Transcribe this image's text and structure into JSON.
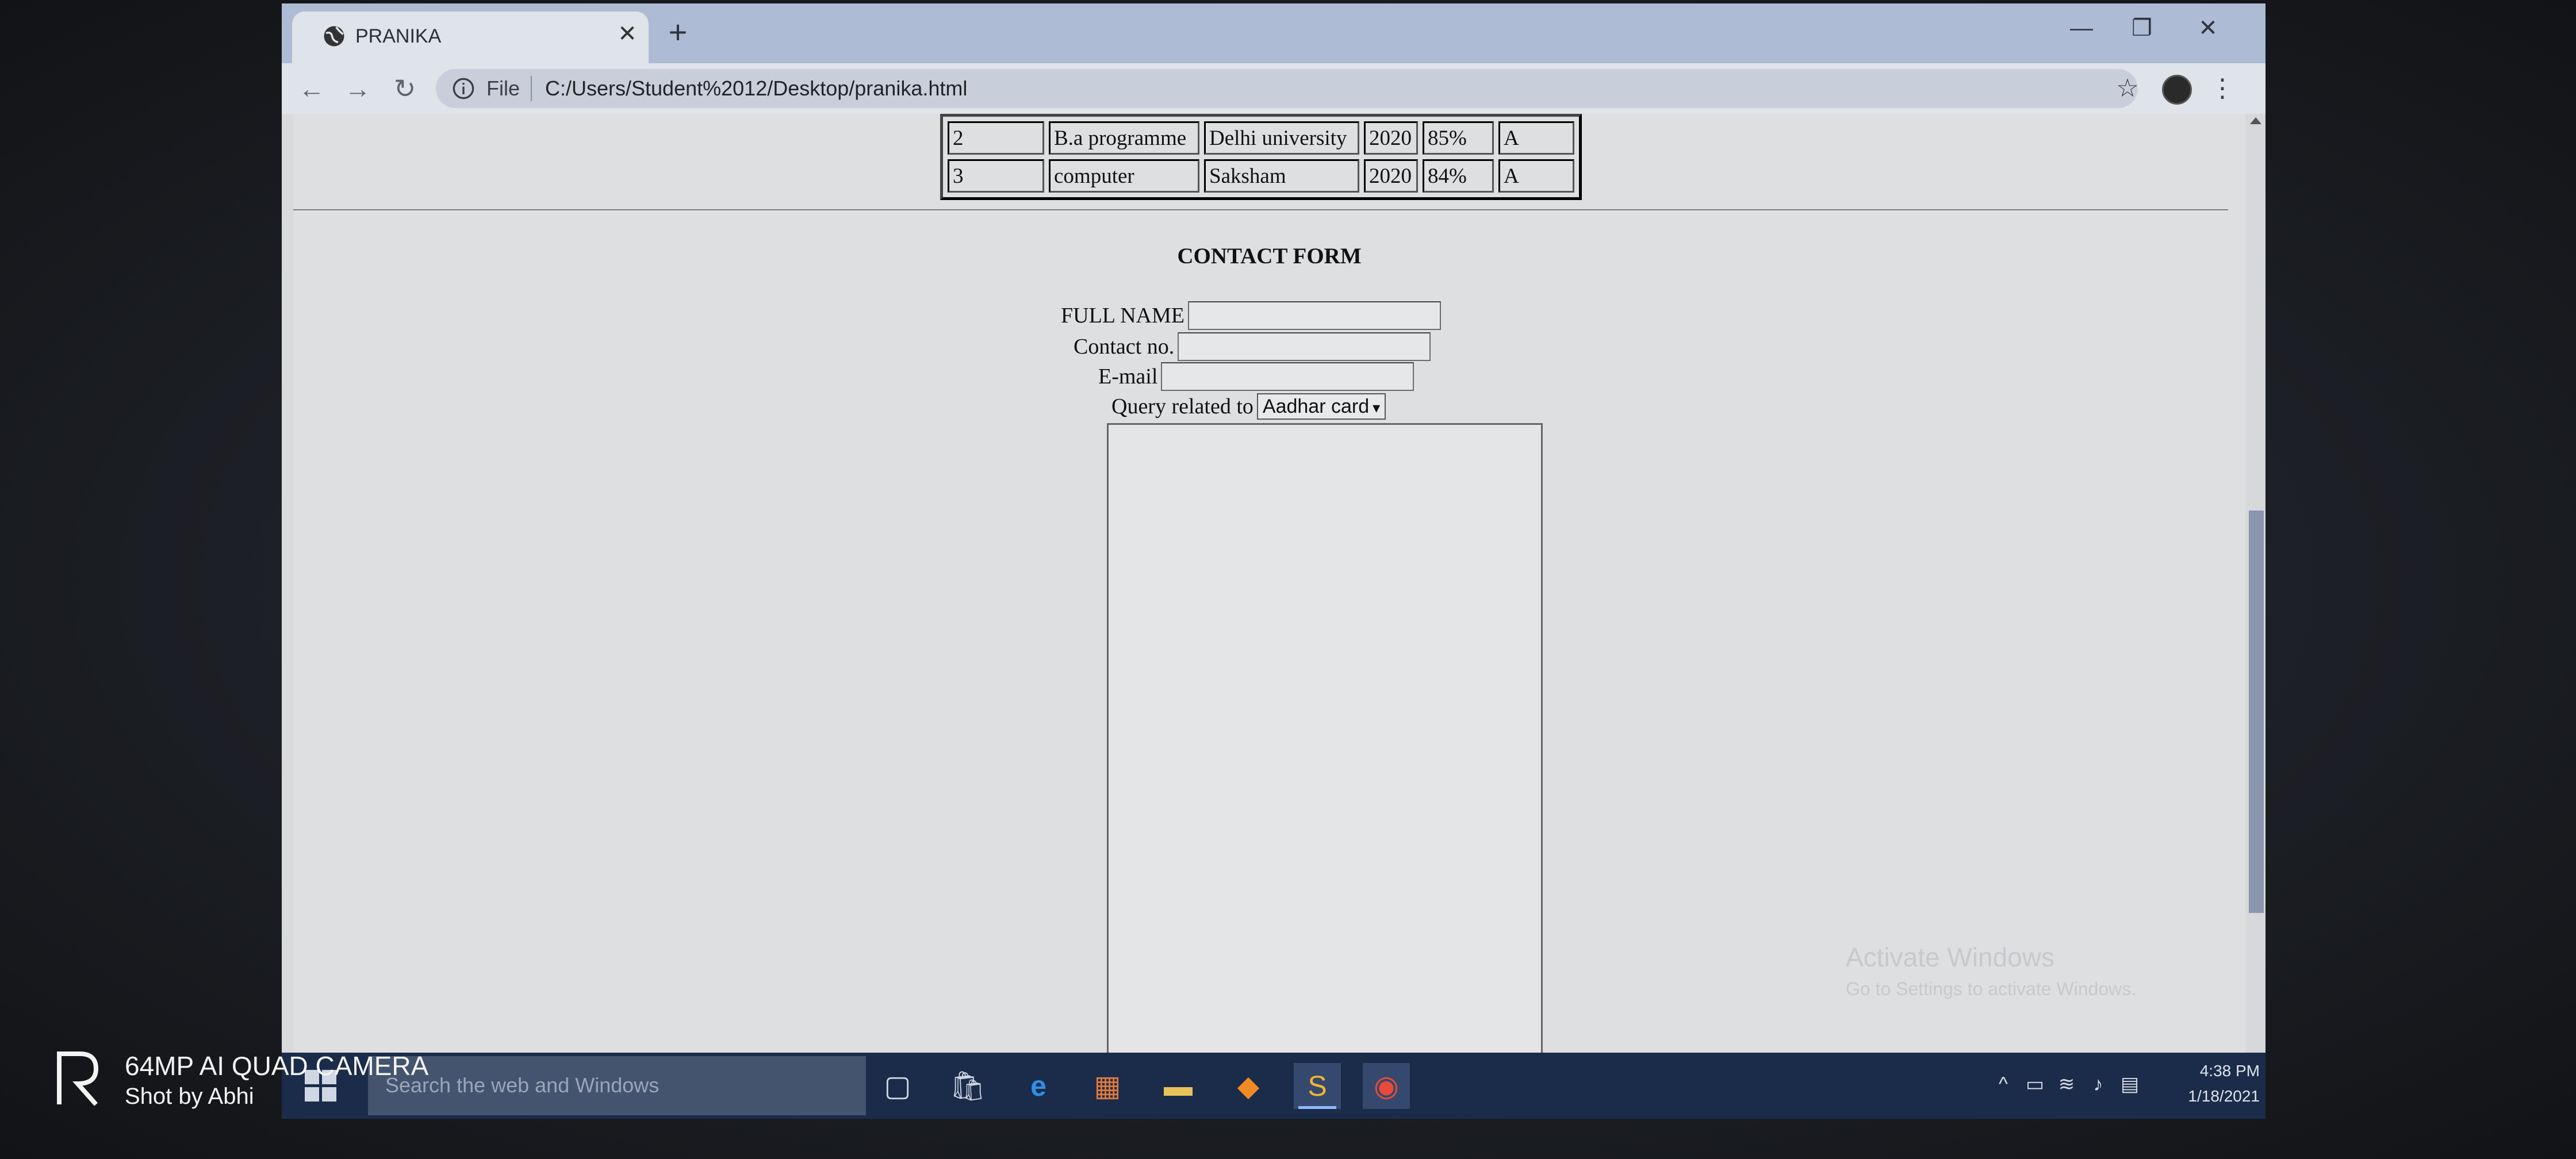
{
  "browser": {
    "tab_title": "PRANIKA",
    "tab_close": "✕",
    "new_tab": "+",
    "scheme_label": "File",
    "url": "C:/Users/Student%2012/Desktop/pranika.html",
    "window_controls": {
      "minimize": "—",
      "restore": "❐",
      "close": "✕"
    },
    "icons": [
      "back-arrow-icon",
      "forward-arrow-icon",
      "reload-icon",
      "info-icon",
      "star-icon",
      "kebab-menu-icon"
    ]
  },
  "page": {
    "table_rows": [
      [
        "2",
        "B.a programme",
        "Delhi university",
        "2020",
        "85%",
        "A"
      ],
      [
        "3",
        "computer",
        "Saksham",
        "2020",
        "84%",
        "A"
      ]
    ],
    "form_title": "CONTACT FORM",
    "fields": {
      "full_name_label": "FULL NAME",
      "contact_label": "Contact no.",
      "email_label": "E-mail",
      "query_label": "Query related to",
      "query_selected": "Aadhar card"
    },
    "watermark_line1": "Activate Windows",
    "watermark_line2": "Go to Settings to activate Windows."
  },
  "taskbar": {
    "search_placeholder": "Search the web and Windows",
    "time": "4:38 PM",
    "date": "1/18/2021"
  },
  "camera": {
    "line1": "64MP AI QUAD CAMERA",
    "line2": "Shot by Abhi"
  }
}
